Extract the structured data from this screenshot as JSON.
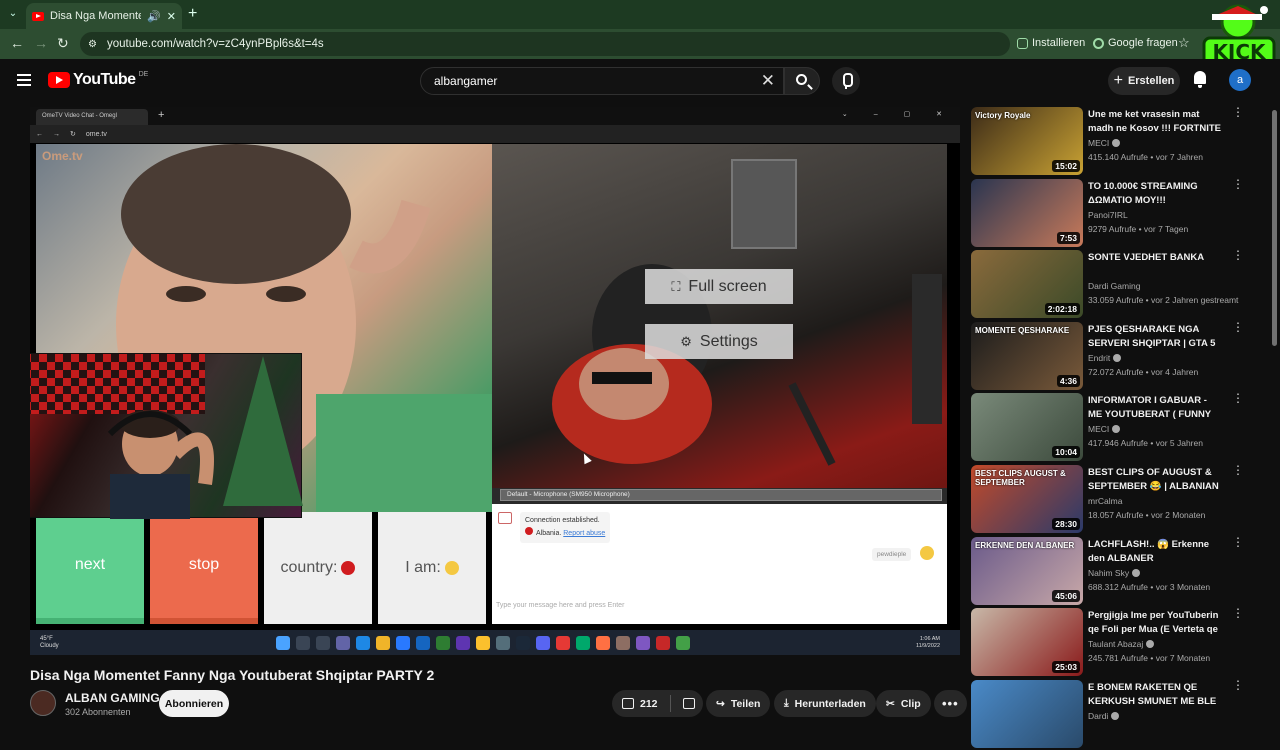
{
  "browser": {
    "tab_title": "Disa Nga Momentet Fanny Nga Y",
    "url": "youtube.com/watch?v=zC4ynPBpl6s&t=4s",
    "install_label": "Installieren",
    "google_label": "Google fragen"
  },
  "youtube": {
    "logo": "YouTube",
    "region": "DE",
    "search_value": "albangamer",
    "create_label": "Erstellen",
    "avatar_letter": "a"
  },
  "video": {
    "inner_tab": "OmeTV Video Chat - Omegl",
    "inner_url": "ome.tv",
    "ome_logo": "Ome.tv",
    "fullscreen_label": "Full screen",
    "settings_label": "Settings",
    "mic_select": "Default - Microphone (SM950 Microphone)",
    "next_label": "next",
    "stop_label": "stop",
    "country_label": "country:",
    "iam_label": "I am:",
    "conn_line1": "Connection established.",
    "conn_country": "Albania.",
    "conn_report": "Report abuse",
    "tag": "pewdieple",
    "chat_placeholder": "Type your message here and press Enter",
    "weather_temp": "45°F",
    "weather_desc": "Cloudy",
    "clock_time": "1:06 AM",
    "clock_date": "11/9/2022"
  },
  "watch": {
    "title": "Disa Nga Momentet Fanny Nga Youtuberat Shqiptar PARTY 2",
    "channel": "ALBAN GAMING",
    "subscribers": "302 Abonnenten",
    "subscribe_label": "Abonnieren",
    "likes": "212",
    "share_label": "Teilen",
    "download_label": "Herunterladen",
    "clip_label": "Clip"
  },
  "recommendations": [
    {
      "title": "Une me ket vrasesin mat madh ne Kosov !!! FORTNITE",
      "channel": "MECI",
      "verified": true,
      "meta": "415.140 Aufrufe • vor 7 Jahren",
      "duration": "15:02",
      "badge": "Victory Royale",
      "color1": "#3c2b18",
      "color2": "#c9a233"
    },
    {
      "title": "TO 10.000€ STREAMING ΔΩΜΑΤΙΟ ΜΟΥ!!!",
      "channel": "Panoi7IRL",
      "verified": false,
      "meta": "9279 Aufrufe • vor 7 Tagen",
      "duration": "7:53",
      "badge": "",
      "color1": "#2a3550",
      "color2": "#c87a5a"
    },
    {
      "title": "SONTE VJEDHET BANKA",
      "channel": "Dardi Gaming",
      "verified": false,
      "meta": "33.059 Aufrufe • vor 2 Jahren gestreamt",
      "duration": "2:02:18",
      "badge": "",
      "color1": "#8a6a3c",
      "color2": "#3b4a28"
    },
    {
      "title": "PJES QESHARAKE NGA SERVERI SHQIPTAR | GTA 5 ...",
      "channel": "Endrit",
      "verified": true,
      "meta": "72.072 Aufrufe • vor 4 Jahren",
      "duration": "4:36",
      "badge": "MOMENTE QESHARAKE",
      "color1": "#1c1c1c",
      "color2": "#7a5a3a"
    },
    {
      "title": "INFORMATOR I GABUAR - ME YOUTUBERAT ( FUNNY 😂😂 )",
      "channel": "MECI",
      "verified": true,
      "meta": "417.946 Aufrufe • vor 5 Jahren",
      "duration": "10:04",
      "badge": "",
      "color1": "#7a8a7a",
      "color2": "#3c4a3c"
    },
    {
      "title": "BEST CLIPS OF AUGUST & SEPTEMBER 😂 | ALBANIAN ...",
      "channel": "mrCalma",
      "verified": false,
      "meta": "18.057 Aufrufe • vor 2 Monaten",
      "duration": "28:30",
      "badge": "BEST CLIPS AUGUST & SEPTEMBER",
      "color1": "#c24a2a",
      "color2": "#2a3a6a"
    },
    {
      "title": "LACHFLASH!.. 😱 Erkenne den ALBANER",
      "channel": "Nahim Sky",
      "verified": true,
      "meta": "688.312 Aufrufe • vor 3 Monaten",
      "duration": "45:06",
      "badge": "ERKENNE DEN ALBANER",
      "color1": "#6a5a8a",
      "color2": "#c8a8a8"
    },
    {
      "title": "Pergjigja Ime per YouTuberin qe Foli per Mua (E Verteta qe Nuk...",
      "channel": "Taulant Abazaj",
      "verified": true,
      "meta": "245.781 Aufrufe • vor 7 Monaten",
      "duration": "25:03",
      "badge": "",
      "color1": "#c8b8a8",
      "color2": "#8a1a1a"
    },
    {
      "title": "E BONEM RAKETEN QE KERKUSH SMUNET ME BLE💀",
      "channel": "Dardi",
      "verified": true,
      "meta": "",
      "duration": "",
      "badge": "",
      "color1": "#4a8ac8",
      "color2": "#2a4a6a"
    }
  ]
}
